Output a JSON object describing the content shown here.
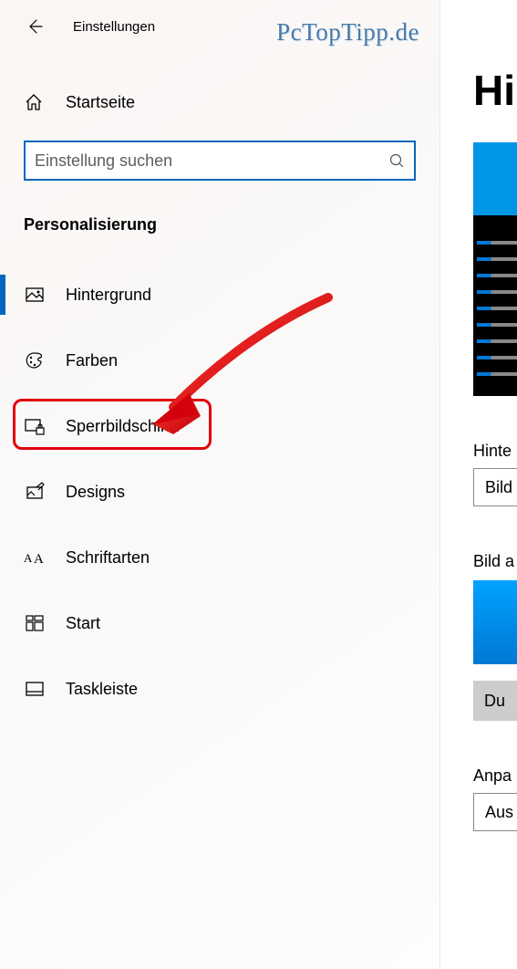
{
  "header": {
    "title": "Einstellungen"
  },
  "watermark": "PcTopTipp.de",
  "home": {
    "label": "Startseite"
  },
  "search": {
    "placeholder": "Einstellung suchen"
  },
  "section": {
    "title": "Personalisierung"
  },
  "nav": [
    {
      "icon": "image-icon",
      "label": "Hintergrund",
      "active": true
    },
    {
      "icon": "palette-icon",
      "label": "Farben"
    },
    {
      "icon": "lockscreen-icon",
      "label": "Sperrbildschirm",
      "highlighted": true
    },
    {
      "icon": "designs-icon",
      "label": "Designs"
    },
    {
      "icon": "fonts-icon",
      "label": "Schriftarten"
    },
    {
      "icon": "start-icon",
      "label": "Start"
    },
    {
      "icon": "taskbar-icon",
      "label": "Taskleiste"
    }
  ],
  "right": {
    "title_fragment": "Hin",
    "field1_label_fragment": "Hinte",
    "field1_value_fragment": "Bild",
    "field2_label_fragment": "Bild a",
    "browse_fragment": "Du",
    "field3_label_fragment": "Anpa",
    "field3_value_fragment": "Aus"
  }
}
